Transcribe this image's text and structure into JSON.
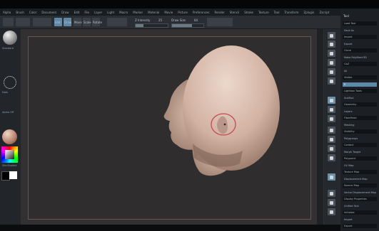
{
  "app": {
    "menu": [
      "Alpha",
      "Brush",
      "Color",
      "Document",
      "Draw",
      "Edit",
      "File",
      "Layer",
      "Light",
      "Macro",
      "Marker",
      "Material",
      "Movie",
      "Picture",
      "Preferences",
      "Render",
      "Stencil",
      "Stroke",
      "Texture",
      "Tool",
      "Transform",
      "Zplugin",
      "Zscript"
    ]
  },
  "toolbar": {
    "buttons": [
      "Edit",
      "Draw",
      "Move",
      "Scale",
      "Rotate"
    ],
    "z_intensity_label": "Z Intensity",
    "z_intensity": 25,
    "draw_size_label": "Draw Size",
    "draw_size": 64
  },
  "left_panel": {
    "brush_label": "Standard",
    "stroke_label": "Dots",
    "alpha_label": "Alpha Off",
    "material_label": "SkinShade4"
  },
  "right_panel": {
    "title": "Tool",
    "rows": [
      "Load Tool",
      "Save As",
      "Import",
      "Export",
      "Clone",
      "Make PolyMesh3D",
      "GoZ",
      "All",
      "Visible",
      "R",
      "Lightbox Tools",
      "SubTool",
      "Geometry",
      "Layers",
      "FiberMesh",
      "Masking",
      "Visibility",
      "Polygroups",
      "Contact",
      "Morph Target",
      "Polypaint",
      "UV Map",
      "Texture Map",
      "Displacement Map",
      "Normal Map",
      "Vector Displacement Map",
      "Display Properties",
      "Unified Skin",
      "Initialize",
      "Import",
      "Export"
    ]
  },
  "colors": {
    "accent": "#5f88a6",
    "head_skin": "#d8b8a8",
    "brush_cursor": "#c84850"
  },
  "icons": [
    "sphere-brush-icon",
    "dots-stroke-icon",
    "material-sphere-icon",
    "color-picker-icon",
    "tool-button-icon"
  ]
}
